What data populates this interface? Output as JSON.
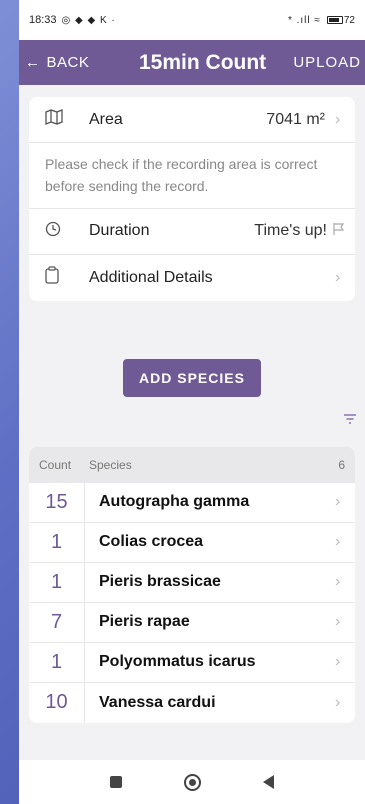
{
  "status": {
    "time": "18:33",
    "icons_left": "◎ ◆ ◆ K ·",
    "icons_right": "* .ıll ≈",
    "battery": "72"
  },
  "header": {
    "back_label": "BACK",
    "title": "15min Count",
    "upload_label": "UPLOAD"
  },
  "details": {
    "area_label": "Area",
    "area_value": "7041 m²",
    "note": "Please check if the recording area is correct before sending the record.",
    "duration_label": "Duration",
    "duration_value": "Time's up!",
    "additional_label": "Additional Details"
  },
  "add_species_label": "ADD SPECIES",
  "list": {
    "count_header": "Count",
    "species_header": "Species",
    "total": "6",
    "rows": [
      {
        "count": "15",
        "name": "Autographa gamma"
      },
      {
        "count": "1",
        "name": "Colias crocea"
      },
      {
        "count": "1",
        "name": "Pieris brassicae"
      },
      {
        "count": "7",
        "name": "Pieris rapae"
      },
      {
        "count": "1",
        "name": "Polyommatus icarus"
      },
      {
        "count": "10",
        "name": "Vanessa cardui"
      }
    ]
  },
  "icons": {
    "map": "map-icon",
    "clock": "clock-icon",
    "clipboard": "clipboard-icon",
    "flag": "flag-icon",
    "filter": "filter-icon"
  },
  "colors": {
    "primary": "#6f5a96"
  }
}
